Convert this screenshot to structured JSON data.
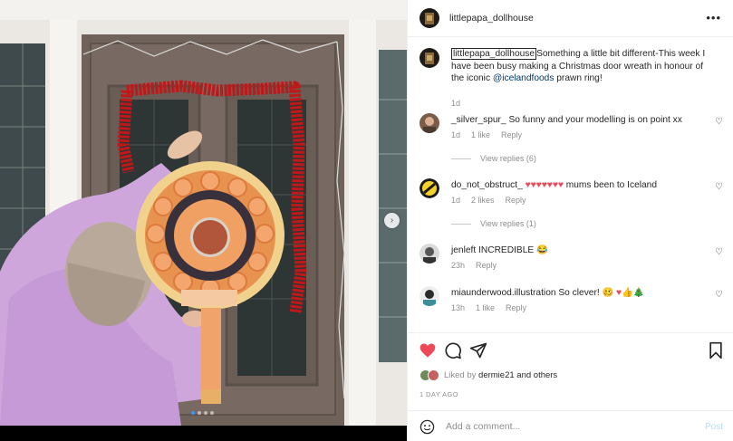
{
  "post": {
    "author": "littlepapa_dollhouse",
    "more_label": "•••",
    "caption": {
      "user": "littlepapa_dollhouse",
      "text_before": "Something a little bit different-This week I have been busy making a Christmas door wreath in honour of the iconic ",
      "mention": "@icelandfoods",
      "text_after": " prawn ring!",
      "time": "1d"
    }
  },
  "carousel": {
    "next_icon": "chevron-right-icon",
    "next_glyph": "›",
    "slides": 4,
    "active_slide": 1
  },
  "comments": [
    {
      "user": "_silver_spur_",
      "text": "So funny and your modelling is on point xx",
      "time": "1d",
      "likes": "1 like",
      "reply": "Reply",
      "view_replies": "View replies (6)"
    },
    {
      "user": "do_not_obstruct_",
      "hearts": "♥♥♥♥♥♥♥",
      "text": "mums been to Iceland",
      "time": "1d",
      "likes": "2 likes",
      "reply": "Reply",
      "view_replies": "View replies (1)"
    },
    {
      "user": "jenleft",
      "text": "INCREDIBLE",
      "emoji": "😂",
      "time": "23h",
      "reply": "Reply"
    },
    {
      "user": "miaunderwood.illustration",
      "text": "So clever!",
      "emoji_a": "🥴",
      "heart": "♥",
      "emoji_b": "👍🎄",
      "time": "13h",
      "likes": "1 like",
      "reply": "Reply"
    }
  ],
  "heart_icon_glyph": "♡",
  "likes_line": {
    "prefix": "Liked by",
    "user": "dermie21",
    "middle": "and",
    "others": "others"
  },
  "timestamp": "1 DAY AGO",
  "add_comment": {
    "placeholder": "Add a comment...",
    "post_label": "Post"
  },
  "colors": {
    "like_red": "#ed4956",
    "link_blue": "#00376b",
    "post_blue": "#b2dffc",
    "dot_active": "#3897f0"
  }
}
